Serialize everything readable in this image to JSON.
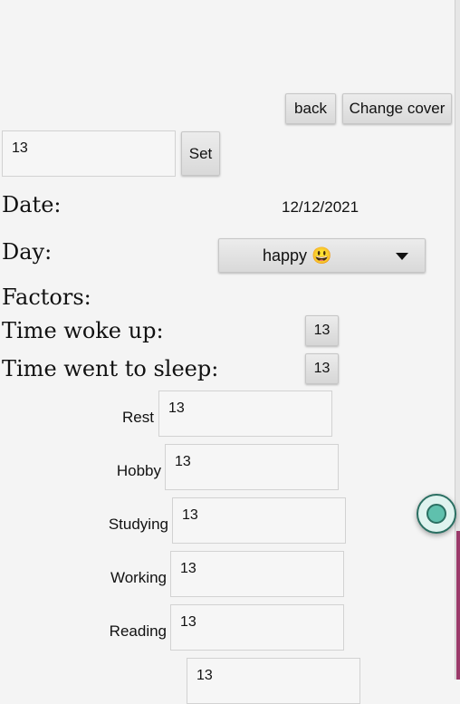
{
  "header": {
    "back_label": "back",
    "change_cover_label": "Change cover"
  },
  "top_input": {
    "value": "13",
    "set_label": "Set"
  },
  "date": {
    "label": "Date:",
    "value": "12/12/2021"
  },
  "day": {
    "label": "Day:",
    "selected": "happy 😃"
  },
  "factors": {
    "heading": "Factors:",
    "time_woke_up_label": "Time woke up:",
    "time_woke_up_value": "13",
    "time_went_to_sleep_label": "Time went to sleep:",
    "time_went_to_sleep_value": "13",
    "items": [
      {
        "label": "Rest",
        "value": "13"
      },
      {
        "label": "Hobby",
        "value": "13"
      },
      {
        "label": "Studying",
        "value": "13"
      },
      {
        "label": "Working",
        "value": "13"
      },
      {
        "label": "Reading",
        "value": "13"
      },
      {
        "label": "",
        "value": "13"
      }
    ]
  }
}
